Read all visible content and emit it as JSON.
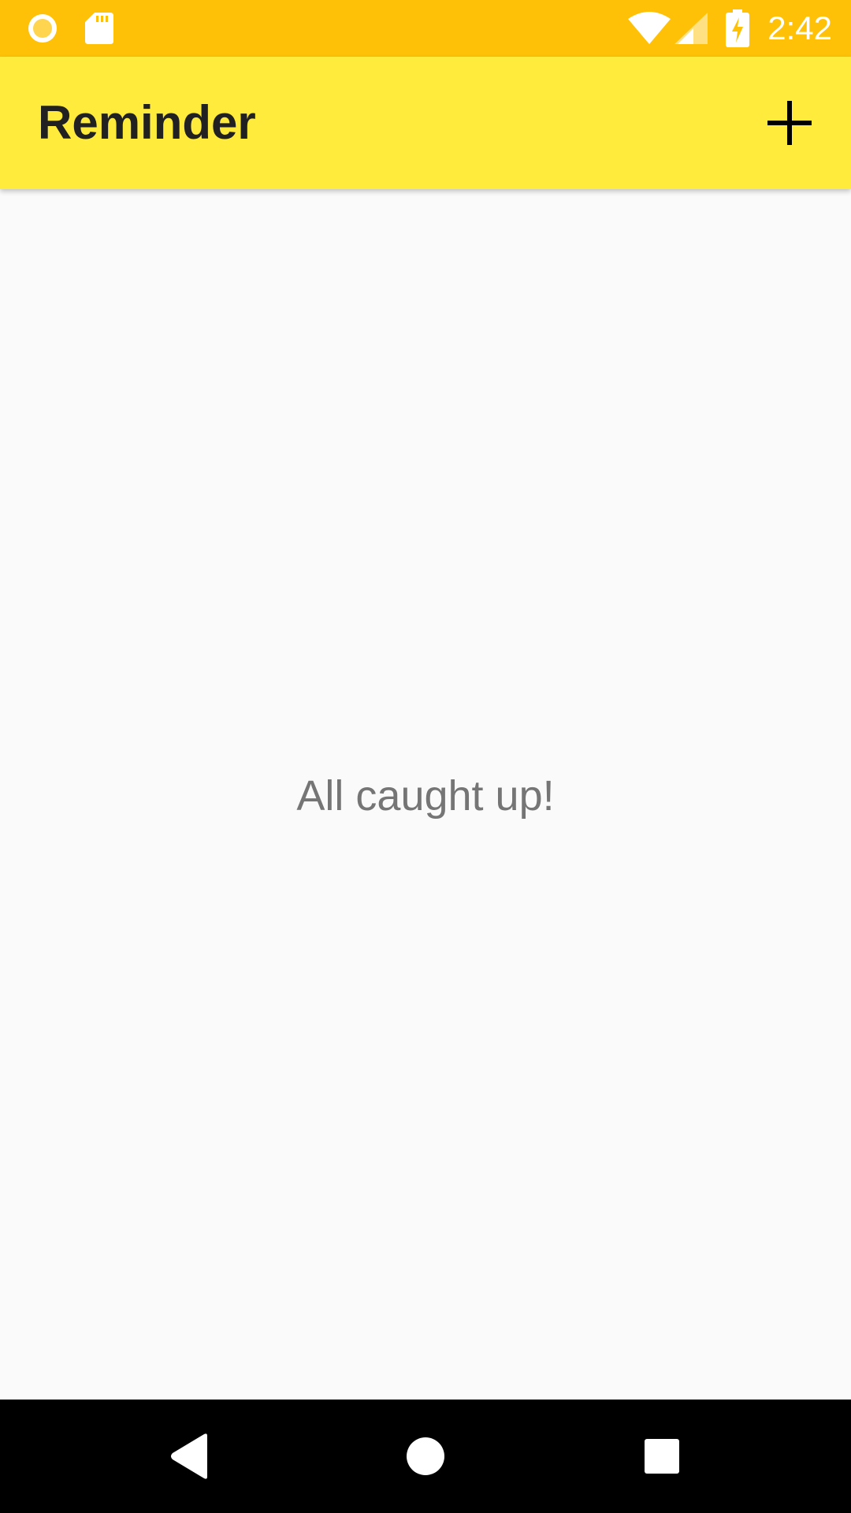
{
  "status_bar": {
    "time": "2:42",
    "background_color": "#FFC107",
    "left_icons": [
      "record-circle-icon",
      "sd-card-icon"
    ],
    "right_icons": [
      "wifi-icon",
      "cell-signal-icon",
      "battery-charging-icon"
    ]
  },
  "app_bar": {
    "title": "Reminder",
    "background_color": "#FFEB3B",
    "action_icon": "add-icon"
  },
  "content": {
    "empty_message": "All caught up!"
  },
  "nav_bar": {
    "buttons": [
      "back-icon",
      "home-icon",
      "recents-icon"
    ]
  }
}
